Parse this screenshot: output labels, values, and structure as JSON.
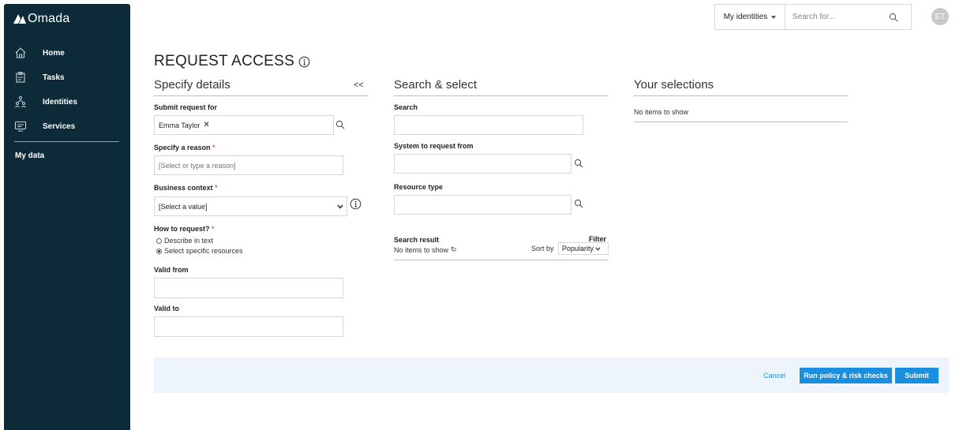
{
  "app": {
    "logo_text": "Omada"
  },
  "sidebar": {
    "items": [
      {
        "label": "Home",
        "icon": "home-icon"
      },
      {
        "label": "Tasks",
        "icon": "tasks-icon"
      },
      {
        "label": "Identities",
        "icon": "identities-icon"
      },
      {
        "label": "Services",
        "icon": "services-icon"
      }
    ],
    "my_data": "My data"
  },
  "topbar": {
    "scope_select": "My identities",
    "search_placeholder": "Search for...",
    "avatar_initials": "ET"
  },
  "page": {
    "title": "REQUEST ACCESS"
  },
  "specify": {
    "heading": "Specify details",
    "collapse": "<<",
    "submit_for_label": "Submit request for",
    "submit_for_value": "Emma Taylor",
    "remove": "✕",
    "reason_label": "Specify a reason",
    "reason_placeholder": "[Select or type a reason]",
    "context_label": "Business context",
    "context_value": "[Select a value]",
    "how_label": "How to request?",
    "how_options": [
      "Describe in text",
      "Select specific resources"
    ],
    "how_selected": 1,
    "valid_from_label": "Valid from",
    "valid_to_label": "Valid to",
    "required_mark": "*"
  },
  "search": {
    "heading": "Search & select",
    "search_label": "Search",
    "system_label": "System to request from",
    "resource_label": "Resource type",
    "result_title": "Search result",
    "result_empty": "No items to show",
    "refresh_glyph": "↻",
    "filter": "Filter",
    "sort_label": "Sort by",
    "sort_value": "Popularity"
  },
  "selections": {
    "heading": "Your selections",
    "empty": "No items to show"
  },
  "footer": {
    "cancel": "Cancel",
    "run_checks": "Run policy & risk checks",
    "submit": "Submit"
  },
  "colors": {
    "sidebar_bg": "#0d2a38",
    "accent": "#1a8fe0",
    "required": "#c8102e",
    "footer_bg": "#eef4fb"
  }
}
